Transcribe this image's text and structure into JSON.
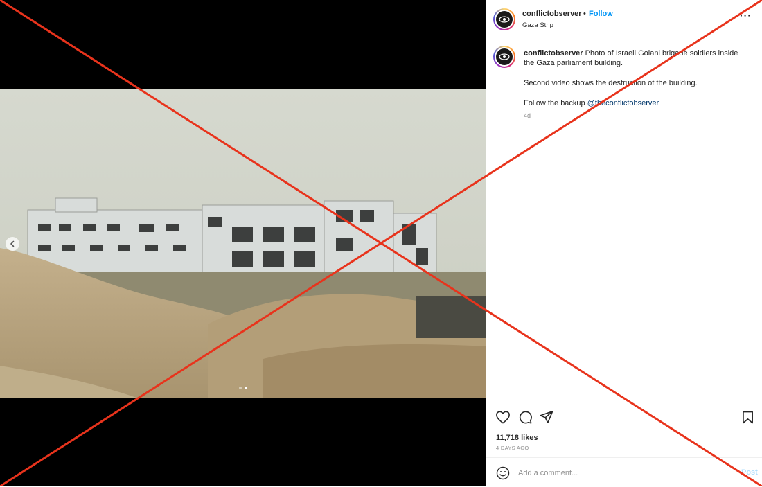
{
  "post": {
    "username": "conflictobserver",
    "separator": "•",
    "follow_label": "Follow",
    "location": "Gaza Strip",
    "more_label": "···",
    "caption": {
      "username": "conflictobserver",
      "text": "Photo of Israeli Golani brigade soldiers inside the Gaza parliament building.",
      "line2": "Second video shows the destruction of the building.",
      "line3_prefix": "Follow the backup ",
      "line3_link": "@theconflictobserver"
    },
    "time_ago": "4d",
    "likes": "11,718 likes",
    "posted": "4 DAYS AGO",
    "comment": {
      "placeholder": "Add a comment...",
      "post_label": "Post"
    }
  },
  "media": {
    "carousel_count": 2,
    "active_index": 1,
    "description_icons": [
      "chevron-left-icon"
    ]
  },
  "icons": [
    "heart-icon",
    "comment-icon",
    "share-icon",
    "bookmark-icon",
    "emoji-icon",
    "more-icon"
  ],
  "colors": {
    "follow": "#0095f6",
    "link": "#00376b",
    "overlay_cross": "#e8331c"
  }
}
